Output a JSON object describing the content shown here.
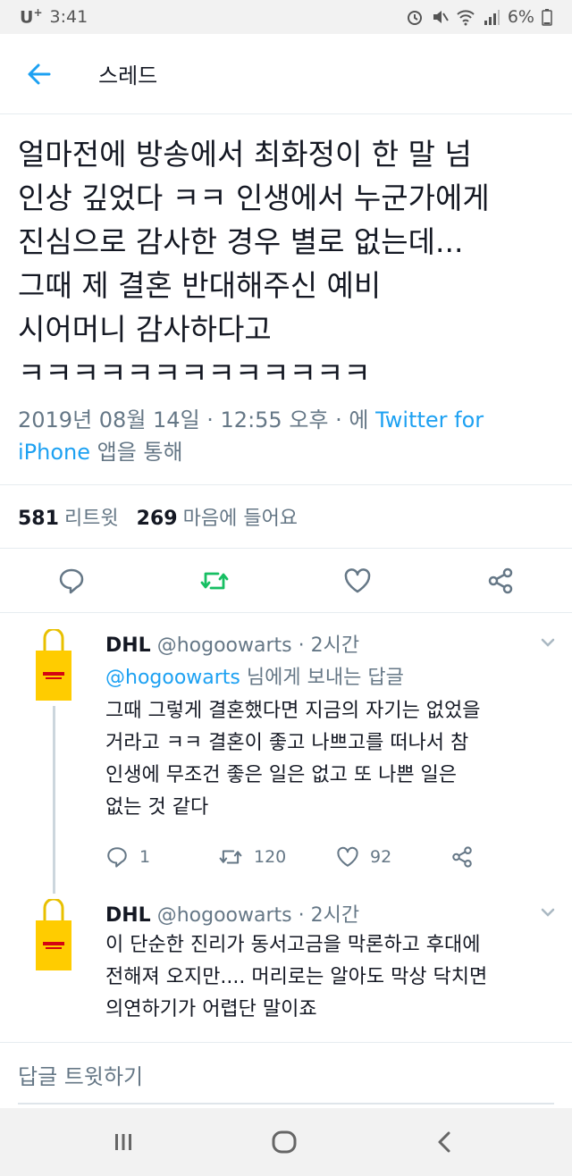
{
  "status_bar": {
    "carrier": "U",
    "carrier_plus": "+",
    "time": "3:41",
    "battery": "6%"
  },
  "app_bar": {
    "title": "스레드",
    "back_icon": "arrow-left-icon"
  },
  "tweet": {
    "text": "얼마전에 방송에서 최화정이 한 말 넘\n인상 깊었다 ㅋㅋ 인생에서 누군가에게\n진심으로 감사한 경우 별로 없는데...\n그때 제 결혼 반대해주신 예비\n시어머니 감사하다고\nㅋㅋㅋㅋㅋㅋㅋㅋㅋㅋㅋㅋㅋ",
    "date": "2019년 08월 14일 · 12:55 오후 · 에 ",
    "source_link": "Twitter for iPhone",
    "source_suffix": " 앱을 통해",
    "retweet_count": "581",
    "retweet_label": "리트윗",
    "like_count": "269",
    "like_label": "마음에 들어요"
  },
  "replies": [
    {
      "name": "DHL",
      "handle": "@hogoowarts",
      "time": "· 2시간",
      "reply_to_handle": "@hogoowarts",
      "reply_to_suffix": " 님에게 보내는 답글",
      "text": "그때 그렇게 결혼했다면 지금의 자기는 없었을\n거라고 ㅋㅋ 결혼이 좋고 나쁘고를 떠나서 참\n인생에 무조건 좋은 일은 없고 또 나쁜 일은\n없는 것 같다",
      "reply_count": "1",
      "retweet_count": "120",
      "like_count": "92"
    },
    {
      "name": "DHL",
      "handle": "@hogoowarts",
      "time": "· 2시간",
      "text": "이 단순한 진리가 동서고금을 막론하고 후대에\n전해져 오지만.... 머리로는 알아도 막상 닥치면\n의연하기가 어렵단 말이죠"
    }
  ],
  "compose": {
    "placeholder": "답글 트윗하기"
  },
  "colors": {
    "accent": "#1da1f2",
    "retweet_green": "#17bf63",
    "secondary_text": "#657786"
  }
}
